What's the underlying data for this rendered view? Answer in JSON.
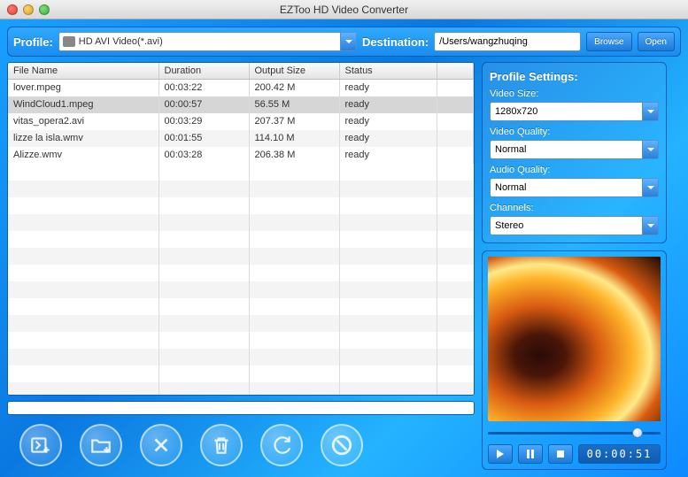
{
  "window": {
    "title": "EZToo HD Video Converter"
  },
  "topbar": {
    "profile_label": "Profile:",
    "profile_value": "HD AVI Video(*.avi)",
    "destination_label": "Destination:",
    "destination_value": "/Users/wangzhuqing",
    "browse": "Browse",
    "open": "Open"
  },
  "table": {
    "headers": {
      "filename": "File Name",
      "duration": "Duration",
      "output_size": "Output Size",
      "status": "Status"
    },
    "rows": [
      {
        "filename": "lover.mpeg",
        "duration": "00:03:22",
        "output_size": "200.42 M",
        "status": "ready",
        "selected": false
      },
      {
        "filename": "WindCloud1.mpeg",
        "duration": "00:00:57",
        "output_size": "56.55 M",
        "status": "ready",
        "selected": true
      },
      {
        "filename": "vitas_opera2.avi",
        "duration": "00:03:29",
        "output_size": "207.37 M",
        "status": "ready",
        "selected": false
      },
      {
        "filename": "lizze la isla.wmv",
        "duration": "00:01:55",
        "output_size": "114.10 M",
        "status": "ready",
        "selected": false
      },
      {
        "filename": "Alizze.wmv",
        "duration": "00:03:28",
        "output_size": "206.38 M",
        "status": "ready",
        "selected": false
      }
    ]
  },
  "settings": {
    "title": "Profile Settings:",
    "video_size": {
      "label": "Video Size:",
      "value": "1280x720"
    },
    "video_quality": {
      "label": "Video Quality:",
      "value": "Normal"
    },
    "audio_quality": {
      "label": "Audio Quality:",
      "value": "Normal"
    },
    "channels": {
      "label": "Channels:",
      "value": "Stereo"
    }
  },
  "player": {
    "time": "00:00:51",
    "progress_pct": 88
  }
}
